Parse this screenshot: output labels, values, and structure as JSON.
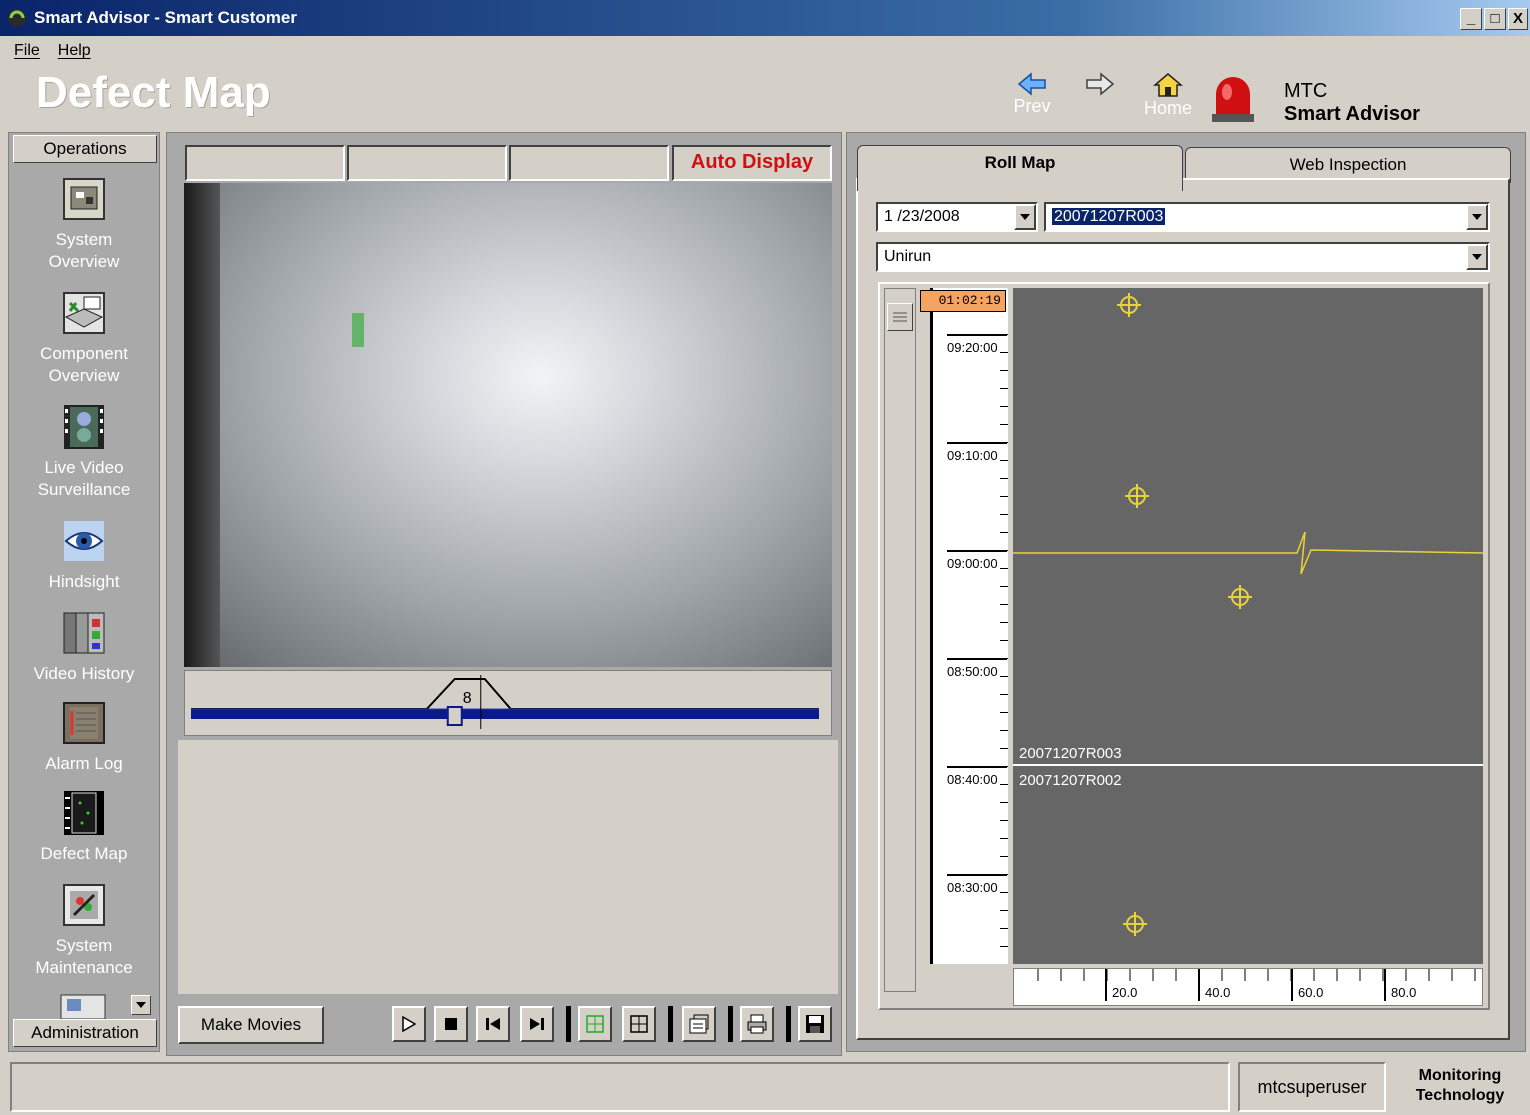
{
  "window": {
    "title": "Smart Advisor - Smart Customer",
    "controls": {
      "minimize": "_",
      "maximize": "□",
      "close": "X"
    }
  },
  "menu": {
    "file": "File",
    "help": "Help"
  },
  "header": {
    "page_title": "Defect Map",
    "nav": {
      "prev": "Prev",
      "home": "Home"
    },
    "brand_line1": "MTC",
    "brand_line2": "Smart Advisor"
  },
  "sidebar": {
    "header": "Operations",
    "items": [
      {
        "label_line1": "System",
        "label_line2": "Overview",
        "icon": "system-overview-icon"
      },
      {
        "label_line1": "Component",
        "label_line2": "Overview",
        "icon": "component-overview-icon"
      },
      {
        "label_line1": "Live Video",
        "label_line2": "Surveillance",
        "icon": "live-video-icon"
      },
      {
        "label_line1": "Hindsight",
        "label_line2": "",
        "icon": "eye-icon"
      },
      {
        "label_line1": "Video History",
        "label_line2": "",
        "icon": "video-history-icon"
      },
      {
        "label_line1": "Alarm Log",
        "label_line2": "",
        "icon": "alarm-log-icon"
      },
      {
        "label_line1": "Defect Map",
        "label_line2": "",
        "icon": "defect-map-icon"
      },
      {
        "label_line1": "System",
        "label_line2": "Maintenance",
        "icon": "system-maintenance-icon"
      }
    ],
    "footer": "Administration"
  },
  "video_panel": {
    "cells": [
      "",
      "",
      ""
    ],
    "auto_display": "Auto Display",
    "slider_value": "8",
    "slider_position": 0.42,
    "make_movies": "Make Movies"
  },
  "roll_panel": {
    "tabs": {
      "roll_map": "Roll Map",
      "web_inspection": "Web Inspection"
    },
    "date": "1 /23/2008",
    "roll_id": "20071207R003",
    "product": "Unirun",
    "current_time": "01:02:19",
    "time_labels": [
      "09:20:00",
      "09:10:00",
      "09:00:00",
      "08:50:00",
      "08:40:00",
      "08:30:00"
    ],
    "roll_labels": [
      "20071207R003",
      "20071207R002"
    ],
    "x_ticks": [
      "20.0",
      "40.0",
      "60.0",
      "80.0"
    ],
    "colors": {
      "map_bg": "#666666",
      "marker": "#e8d23a",
      "time_badge": "#f4a460"
    }
  },
  "status": {
    "user": "mtcsuperuser",
    "company_line1": "Monitoring",
    "company_line2": "Technology"
  }
}
